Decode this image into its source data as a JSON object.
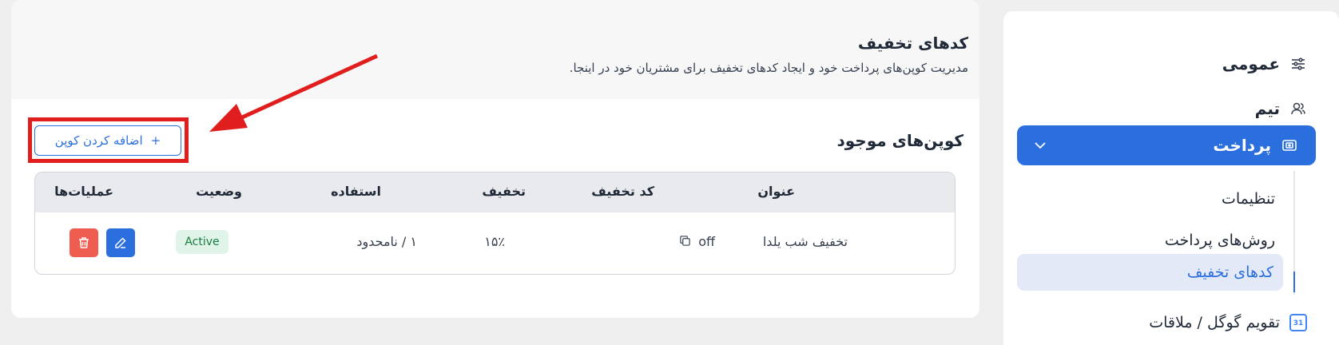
{
  "sidebar": {
    "general": "عمومی",
    "team": "تیم",
    "payment": "پرداخت",
    "sub": {
      "settings": "تنظیمات",
      "methods": "روش‌های پرداخت",
      "discount": "کدهای تخفیف"
    },
    "calendar": "تقویم گوگل / ملاقات",
    "calendar_icon_text": "31"
  },
  "main": {
    "title": "کدهای تخفیف",
    "description": "مدیریت کوپن‌های پرداخت خود و ایجاد کدهای تخفیف برای مشتریان خود در اینجا.",
    "section_title": "کوپن‌های موجود",
    "add_button": "اضافه کردن کوپن",
    "add_icon": "+"
  },
  "table": {
    "headers": {
      "title": "عنوان",
      "code": "کد تخفیف",
      "discount": "تخفیف",
      "usage": "استفاده",
      "status": "وضعیت",
      "actions": "عملیات‌ها"
    },
    "rows": [
      {
        "title": "تخفیف شب یلدا",
        "code": "off",
        "discount": "۱۵٪",
        "usage": "۱ / نامحدود",
        "status": "Active"
      }
    ]
  },
  "colors": {
    "accent": "#2b6fde",
    "highlight": "#e01e1e",
    "delete": "#ef5c50",
    "active_badge_bg": "#e1f4ea",
    "active_badge_text": "#15803d"
  }
}
